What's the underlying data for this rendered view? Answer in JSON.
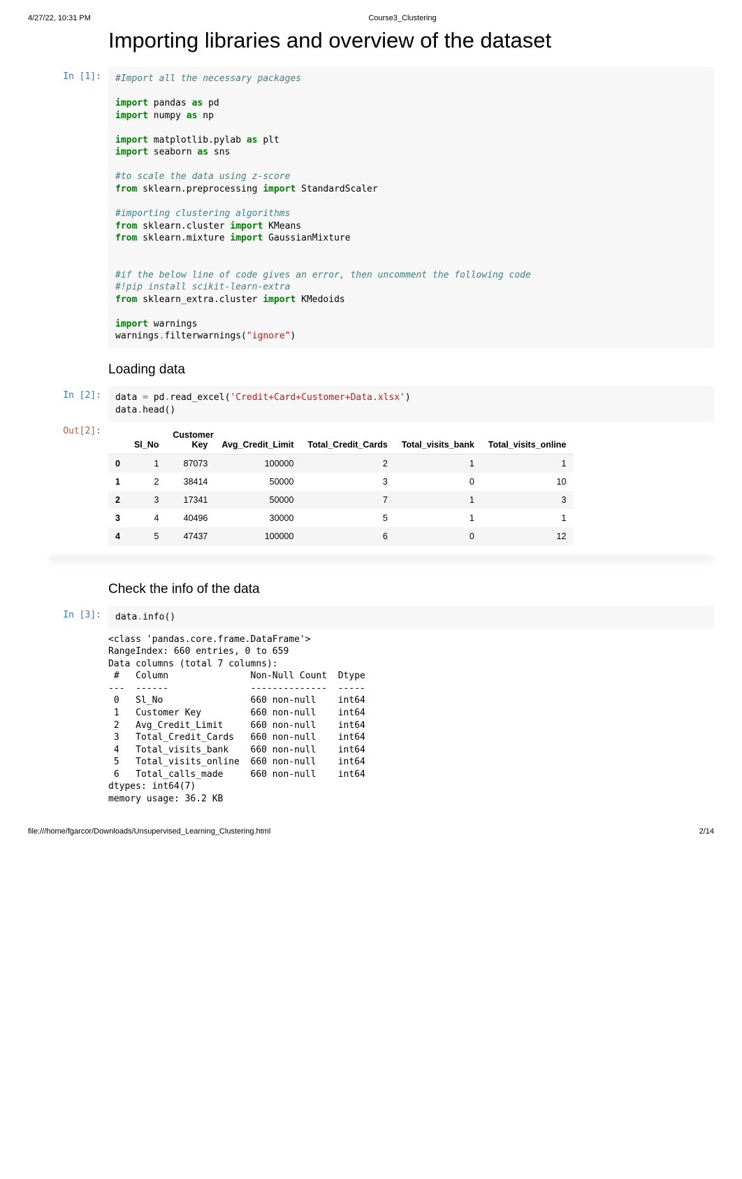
{
  "header": {
    "left": "4/27/22, 10:31 PM",
    "center": "Course3_Clustering"
  },
  "title": "Importing libraries and overview of the dataset",
  "cell1": {
    "prompt": "In [1]:",
    "code": {
      "l1": "#Import all the necessary packages",
      "l2a": "import",
      "l2b": " pandas ",
      "l2c": "as",
      "l2d": " pd",
      "l3a": "import",
      "l3b": " numpy ",
      "l3c": "as",
      "l3d": " np",
      "l4a": "import",
      "l4b": " matplotlib.pylab ",
      "l4c": "as",
      "l4d": " plt",
      "l5a": "import",
      "l5b": " seaborn ",
      "l5c": "as",
      "l5d": " sns",
      "l6": "#to scale the data using z-score",
      "l7a": "from",
      "l7b": " sklearn.preprocessing ",
      "l7c": "import",
      "l7d": " StandardScaler",
      "l8": "#importing clustering algorithms",
      "l9a": "from",
      "l9b": " sklearn.cluster ",
      "l9c": "import",
      "l9d": " KMeans",
      "l10a": "from",
      "l10b": " sklearn.mixture ",
      "l10c": "import",
      "l10d": " GaussianMixture",
      "l11": "#if the below line of code gives an error, then uncomment the following code",
      "l12": "#!pip install scikit-learn-extra",
      "l13a": "from",
      "l13b": " sklearn_extra.cluster ",
      "l13c": "import",
      "l13d": " KMedoids",
      "l14a": "import",
      "l14b": " warnings",
      "l15a": "warnings",
      "l15b": ".",
      "l15c": "filterwarnings",
      "l15d": "(",
      "l15e": "\"ignore\"",
      "l15f": ")"
    }
  },
  "h_loading": "Loading data",
  "cell2": {
    "prompt": "In [2]:",
    "code": {
      "l1a": "data ",
      "l1b": "=",
      "l1c": " pd",
      "l1d": ".",
      "l1e": "read_excel",
      "l1f": "(",
      "l1g": "'Credit+Card+Customer+Data.xlsx'",
      "l1h": ")",
      "l2a": "data",
      "l2b": ".",
      "l2c": "head",
      "l2d": "(",
      "l2e": ")"
    }
  },
  "out2": {
    "prompt": "Out[2]:"
  },
  "table": {
    "headers": [
      "",
      "Sl_No",
      "Customer Key",
      "Avg_Credit_Limit",
      "Total_Credit_Cards",
      "Total_visits_bank",
      "Total_visits_online"
    ],
    "rows": [
      [
        "0",
        "1",
        "87073",
        "100000",
        "2",
        "1",
        "1"
      ],
      [
        "1",
        "2",
        "38414",
        "50000",
        "3",
        "0",
        "10"
      ],
      [
        "2",
        "3",
        "17341",
        "50000",
        "7",
        "1",
        "3"
      ],
      [
        "3",
        "4",
        "40496",
        "30000",
        "5",
        "1",
        "1"
      ],
      [
        "4",
        "5",
        "47437",
        "100000",
        "6",
        "0",
        "12"
      ]
    ]
  },
  "h_check": "Check the info of the data",
  "cell3": {
    "prompt": "In [3]:",
    "code": {
      "l1a": "data",
      "l1b": ".",
      "l1c": "info",
      "l1d": "(",
      "l1e": ")"
    }
  },
  "info_output": "<class 'pandas.core.frame.DataFrame'>\nRangeIndex: 660 entries, 0 to 659\nData columns (total 7 columns):\n #   Column               Non-Null Count  Dtype\n---  ------               --------------  -----\n 0   Sl_No                660 non-null    int64\n 1   Customer Key         660 non-null    int64\n 2   Avg_Credit_Limit     660 non-null    int64\n 3   Total_Credit_Cards   660 non-null    int64\n 4   Total_visits_bank    660 non-null    int64\n 5   Total_visits_online  660 non-null    int64\n 6   Total_calls_made     660 non-null    int64\ndtypes: int64(7)\nmemory usage: 36.2 KB",
  "footer": {
    "left": "file:///home/fgarcor/Downloads/Unsupervised_Learning_Clustering.html",
    "right": "2/14"
  }
}
